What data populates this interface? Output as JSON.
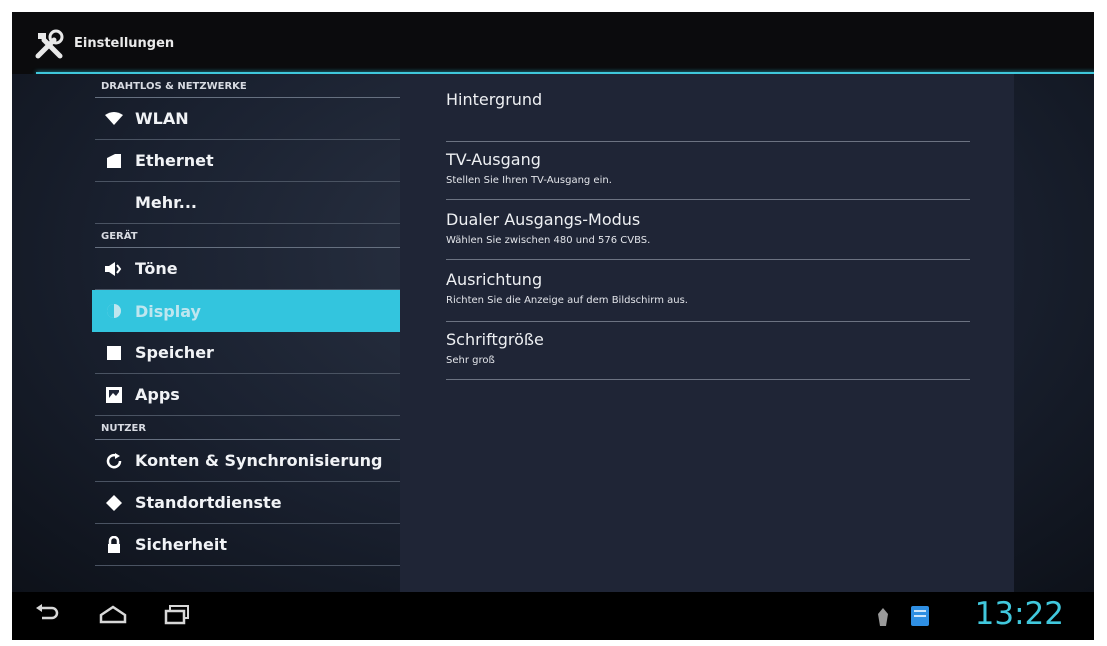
{
  "header": {
    "title": "Einstellungen"
  },
  "sidebar": {
    "sections": [
      {
        "header": "DRAHTLOS & NETZWERKE",
        "items": [
          {
            "label": "WLAN",
            "icon": "wifi-icon"
          },
          {
            "label": "Ethernet",
            "icon": "ethernet-icon"
          },
          {
            "label": "Mehr...",
            "icon": ""
          }
        ]
      },
      {
        "header": "GERÄT",
        "items": [
          {
            "label": "Töne",
            "icon": "speaker-icon"
          },
          {
            "label": "Display",
            "icon": "brightness-icon",
            "selected": true
          },
          {
            "label": "Speicher",
            "icon": "storage-icon"
          },
          {
            "label": "Apps",
            "icon": "apps-icon"
          }
        ]
      },
      {
        "header": "NUTZER",
        "items": [
          {
            "label": "Konten & Synchronisierung",
            "icon": "sync-icon"
          },
          {
            "label": "Standortdienste",
            "icon": "location-icon"
          },
          {
            "label": "Sicherheit",
            "icon": "lock-icon"
          }
        ]
      }
    ]
  },
  "detail": {
    "items": [
      {
        "title": "Hintergrund",
        "summary": ""
      },
      {
        "title": "TV-Ausgang",
        "summary": "Stellen Sie Ihren TV-Ausgang ein."
      },
      {
        "title": "Dualer Ausgangs-Modus",
        "summary": "Wählen Sie zwischen 480 und 576 CVBS."
      },
      {
        "title": "Ausrichtung",
        "summary": "Richten Sie die Anzeige auf dem Bildschirm aus."
      },
      {
        "title": "Schriftgröße",
        "summary": "Sehr groß"
      }
    ]
  },
  "statusbar": {
    "time": "13:22",
    "icons": [
      "back-icon",
      "home-icon",
      "recent-apps-icon",
      "debug-icon",
      "notification-icon"
    ]
  },
  "colors": {
    "accent": "#33c5de",
    "clock": "#41c8dd",
    "background": "#1f2536"
  }
}
